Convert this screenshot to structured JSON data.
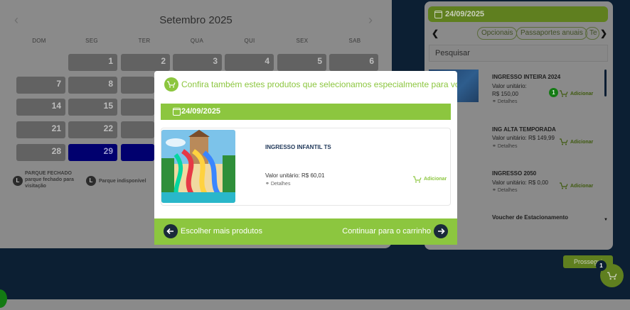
{
  "calendar": {
    "month": "Setembro 2025",
    "prev_icon": "‹",
    "next_icon": "›",
    "weekdays": [
      "DOM",
      "SEG",
      "TER",
      "QUA",
      "QUI",
      "SEX",
      "SAB"
    ],
    "days": [
      "1",
      "2",
      "3",
      "4",
      "5",
      "6",
      "7",
      "8",
      "14",
      "15",
      "21",
      "22",
      "28",
      "29"
    ],
    "legend": {
      "closed_icon": "L",
      "closed_title": "PARQUE FECHADO",
      "closed_desc_1": "parque fechado para",
      "closed_desc_2": "visitação",
      "unavailable_icon": "L",
      "unavailable_text": "Parque indisponível"
    }
  },
  "products_panel": {
    "date": "24/09/2025",
    "tabs": [
      "Opcionais",
      "Passaportes anuais",
      "Te"
    ],
    "search_placeholder": "Pesquisar",
    "items": [
      {
        "name": "INGRESSO INTEIRA 2024",
        "price_label": "Valor unitário:",
        "price": "R$ 150,00",
        "details": "Detalhes",
        "add": "Adicionar",
        "count": "1"
      },
      {
        "name": "ING ALTA TEMPORADA",
        "price_line": "Valor unitário: R$ 149,99",
        "details": "Detalhes",
        "add": "Adicionar"
      },
      {
        "name": "INGRESSO 2050",
        "price_line": "Valor unitário: R$ 0,00",
        "details": "Detalhes",
        "add": "Adicionar"
      },
      {
        "name": "Voucher de Estacionamento"
      }
    ]
  },
  "page": {
    "proseguir": "Prossegui",
    "cart_count": "1"
  },
  "modal": {
    "title": "Confira também estes produtos que selecionamos especialmente para você!",
    "date": "24/09/2025",
    "product": {
      "name": "INGRESSO INFANTIL TS",
      "price": "Valor unitário: R$ 60,01",
      "details": "Detalhes",
      "add": "Adicionar"
    },
    "back_button": "Escolher mais produtos",
    "continue_button": "Continuar para o carrinho"
  },
  "colors": {
    "accent_green": "#8cc63f",
    "selected_day": "#01006e",
    "dark_navy": "#0c1f33"
  }
}
